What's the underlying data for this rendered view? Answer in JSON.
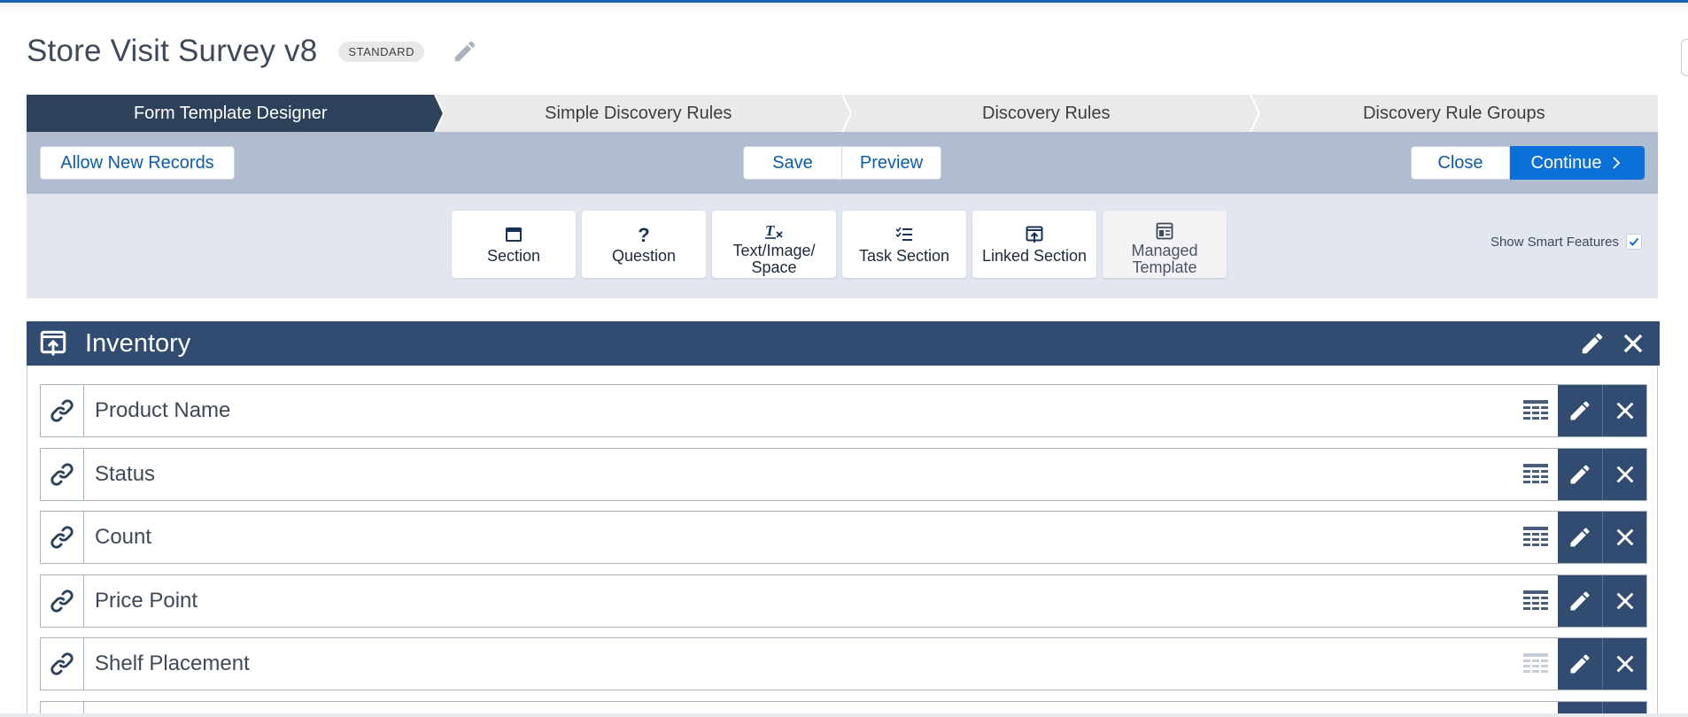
{
  "page": {
    "title": "Store Visit Survey v8",
    "badge": "STANDARD"
  },
  "path": {
    "steps": [
      {
        "label": "Form Template Designer",
        "active": true
      },
      {
        "label": "Simple Discovery Rules",
        "active": false
      },
      {
        "label": "Discovery Rules",
        "active": false
      },
      {
        "label": "Discovery Rule Groups",
        "active": false
      }
    ]
  },
  "toolbar": {
    "allow_new_records": "Allow New Records",
    "save": "Save",
    "preview": "Preview",
    "close": "Close",
    "continue": "Continue"
  },
  "palette": {
    "tools": [
      {
        "label": "Section",
        "icon": "section-icon"
      },
      {
        "label": "Question",
        "icon": "question-icon"
      },
      {
        "label": "Text/Image/ Space",
        "icon": "clear-format-icon"
      },
      {
        "label": "Task Section",
        "icon": "task-list-icon"
      },
      {
        "label": "Linked Section",
        "icon": "linked-section-icon"
      },
      {
        "label": "Managed Template",
        "icon": "template-icon"
      }
    ],
    "smart_features_label": "Show Smart Features",
    "smart_features_checked": true
  },
  "section": {
    "title": "Inventory",
    "questions": [
      {
        "label": "Product Name",
        "table_icon_active": true
      },
      {
        "label": "Status",
        "table_icon_active": true
      },
      {
        "label": "Count",
        "table_icon_active": true
      },
      {
        "label": "Price Point",
        "table_icon_active": true
      },
      {
        "label": "Shelf Placement",
        "table_icon_active": false
      }
    ]
  },
  "colors": {
    "brand": "#0b70d8",
    "header_dark": "#324c71",
    "path_active": "#2e415a",
    "link_text": "#0b5cab"
  }
}
